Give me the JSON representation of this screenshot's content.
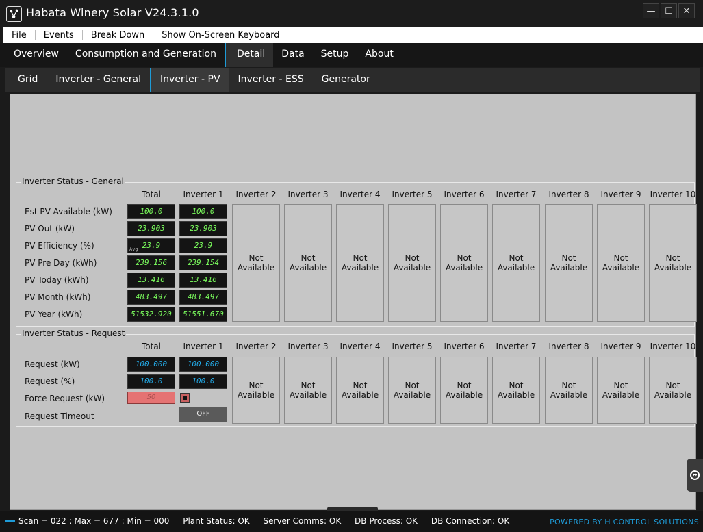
{
  "window": {
    "title": "Habata Winery Solar V24.3.1.0",
    "controls": [
      "—",
      "☐",
      "✕"
    ]
  },
  "menu": [
    "File",
    "Events",
    "Break Down",
    "Show On-Screen Keyboard"
  ],
  "main_tabs": [
    "Overview",
    "Consumption and Generation",
    "Detail",
    "Data",
    "Setup",
    "About"
  ],
  "active_main_tab": "Detail",
  "sub_tabs": [
    "Grid",
    "Inverter - General",
    "Inverter - PV",
    "Inverter - ESS",
    "Generator"
  ],
  "active_sub_tab": "Inverter - PV",
  "columns": [
    "Total",
    "Inverter 1",
    "Inverter 2",
    "Inverter 3",
    "Inverter 4",
    "Inverter 5",
    "Inverter 6",
    "Inverter 7",
    "Inverter 8",
    "Inverter 9",
    "Inverter 10"
  ],
  "not_available": "Not\nAvailable",
  "general": {
    "title": "Inverter Status - General",
    "avg_label": "Avg",
    "rows": [
      {
        "label": "Est PV Available (kW)",
        "total": "100.0",
        "inv1": "100.0"
      },
      {
        "label": "PV Out (kW)",
        "total": "23.903",
        "inv1": "23.903"
      },
      {
        "label": "PV Efficiency (%)",
        "total": "23.9",
        "inv1": "23.9"
      },
      {
        "label": "PV Pre Day (kWh)",
        "total": "239.156",
        "inv1": "239.154"
      },
      {
        "label": "PV Today (kWh)",
        "total": "13.416",
        "inv1": "13.416"
      },
      {
        "label": "PV Month (kWh)",
        "total": "483.497",
        "inv1": "483.497"
      },
      {
        "label": "PV Year (kWh)",
        "total": "51532.920",
        "inv1": "51551.670"
      }
    ]
  },
  "request": {
    "title": "Inverter Status - Request",
    "rows": [
      {
        "label": "Request (kW)",
        "total": "100.000",
        "inv1": "100.000"
      },
      {
        "label": "Request (%)",
        "total": "100.0",
        "inv1": "100.0"
      },
      {
        "label": "Force Request (kW)",
        "total": "50",
        "inv1": ""
      },
      {
        "label": "Request Timeout",
        "total": "",
        "inv1": "OFF"
      }
    ]
  },
  "status": {
    "scan": "Scan = 022 : Max = 677 : Min = 000",
    "plant": "Plant Status: OK",
    "server": "Server Comms: OK",
    "db_process": "DB Process:  OK",
    "db_connection": "DB Connection: OK",
    "powered": "POWERED BY H CONTROL SOLUTIONS"
  },
  "colors": {
    "accent": "#1e9bd7",
    "value_green": "#7cff5e",
    "value_blue": "#23a8e4",
    "force_red": "#e57373"
  }
}
